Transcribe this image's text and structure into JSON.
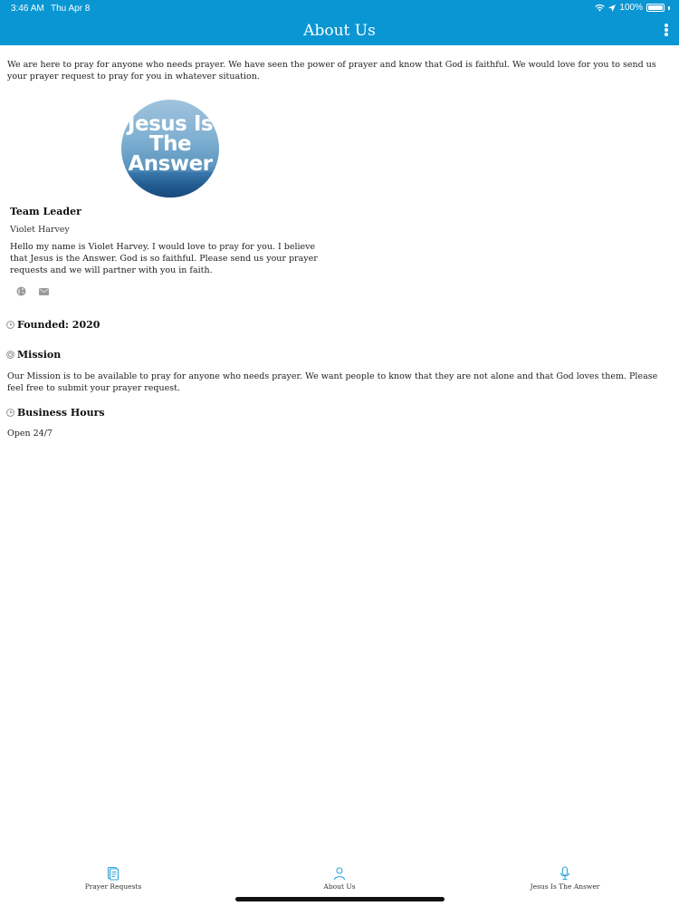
{
  "status_bar": {
    "time": "3:46 AM",
    "date": "Thu Apr 8",
    "battery": "100%"
  },
  "header": {
    "title": "About Us"
  },
  "intro": "We are here to pray for anyone who needs prayer. We have seen the power of prayer and know that God is faithful. We would love for you to send us your prayer request to pray for you in whatever situation.",
  "logo": {
    "lines": [
      "Jesus Is",
      "The",
      "Answer"
    ]
  },
  "team": {
    "heading": "Team Leader",
    "name": "Violet Harvey",
    "bio": "Hello my name is Violet Harvey. I would love to pray for you. I believe that Jesus is the Answer. God is so faithful. Please send us your prayer requests and we will partner with you in faith."
  },
  "founded": {
    "label": "Founded: 2020"
  },
  "mission": {
    "label": "Mission",
    "text": "Our Mission is to be available to pray for anyone who needs prayer. We want people to know that they are not alone and that God loves them. Please feel free to submit your prayer request."
  },
  "business_hours": {
    "label": "Business Hours",
    "text": "Open 24/7"
  },
  "tabs": [
    {
      "label": "Prayer Requests",
      "icon": "document-icon"
    },
    {
      "label": "About Us",
      "icon": "person-icon"
    },
    {
      "label": "Jesus Is The Answer",
      "icon": "microphone-icon"
    }
  ],
  "colors": {
    "brand": "#0a96d3",
    "icon": "#2fa4d8"
  }
}
